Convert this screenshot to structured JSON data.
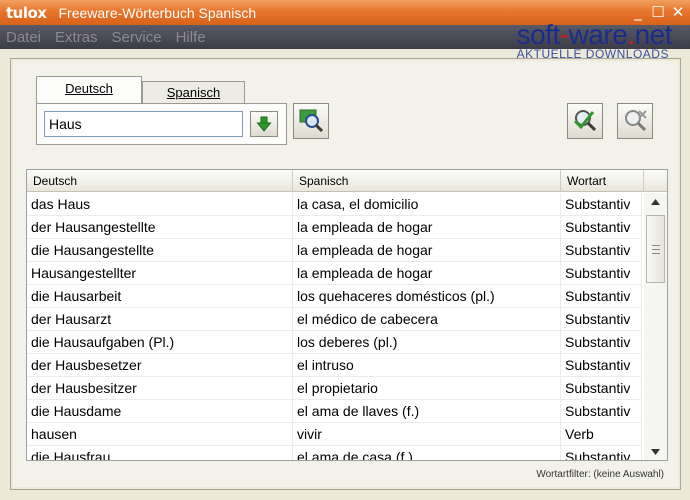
{
  "window": {
    "logo": "tulox",
    "title": "Freeware-Wörterbuch Spanisch",
    "controls": [
      "_",
      "☐",
      "✕"
    ]
  },
  "menu": [
    "Datei",
    "Extras",
    "Service",
    "Hilfe"
  ],
  "watermark": {
    "brand_part1": "soft",
    "brand_dash": "-",
    "brand_part2": "ware",
    "brand_dot": ".",
    "brand_part3": "net",
    "tagline": "AKTUELLE DOWNLOADS"
  },
  "tabs": [
    {
      "label": "Deutsch",
      "active": true
    },
    {
      "label": "Spanisch",
      "active": false
    }
  ],
  "search": {
    "value": "Haus"
  },
  "columns": [
    "Deutsch",
    "Spanisch",
    "Wortart"
  ],
  "rows": [
    [
      "das Haus",
      "la casa, el domicilio",
      "Substantiv"
    ],
    [
      "der Hausangestellte",
      "la empleada de hogar",
      "Substantiv"
    ],
    [
      "die Hausangestellte",
      "la empleada de hogar",
      "Substantiv"
    ],
    [
      "Hausangestellter",
      "la empleada de hogar",
      "Substantiv"
    ],
    [
      "die Hausarbeit",
      "los quehaceres domésticos (pl.)",
      "Substantiv"
    ],
    [
      "der Hausarzt",
      "el médico de cabecera",
      "Substantiv"
    ],
    [
      "die Hausaufgaben (Pl.)",
      "los deberes (pl.)",
      "Substantiv"
    ],
    [
      "der Hausbesetzer",
      "el intruso",
      "Substantiv"
    ],
    [
      "der Hausbesitzer",
      "el propietario",
      "Substantiv"
    ],
    [
      "die Hausdame",
      "el ama de llaves (f.)",
      "Substantiv"
    ],
    [
      "hausen",
      "vivir",
      "Verb"
    ],
    [
      "die Hausfrau",
      "el ama de casa (f.)",
      "Substantiv"
    ]
  ],
  "status": "Wortartfilter: (keine Auswahl)",
  "colors": {
    "titlebar": "#e7762c",
    "menubar": "#4a4a56",
    "accent_green": "#2e9a2e"
  }
}
